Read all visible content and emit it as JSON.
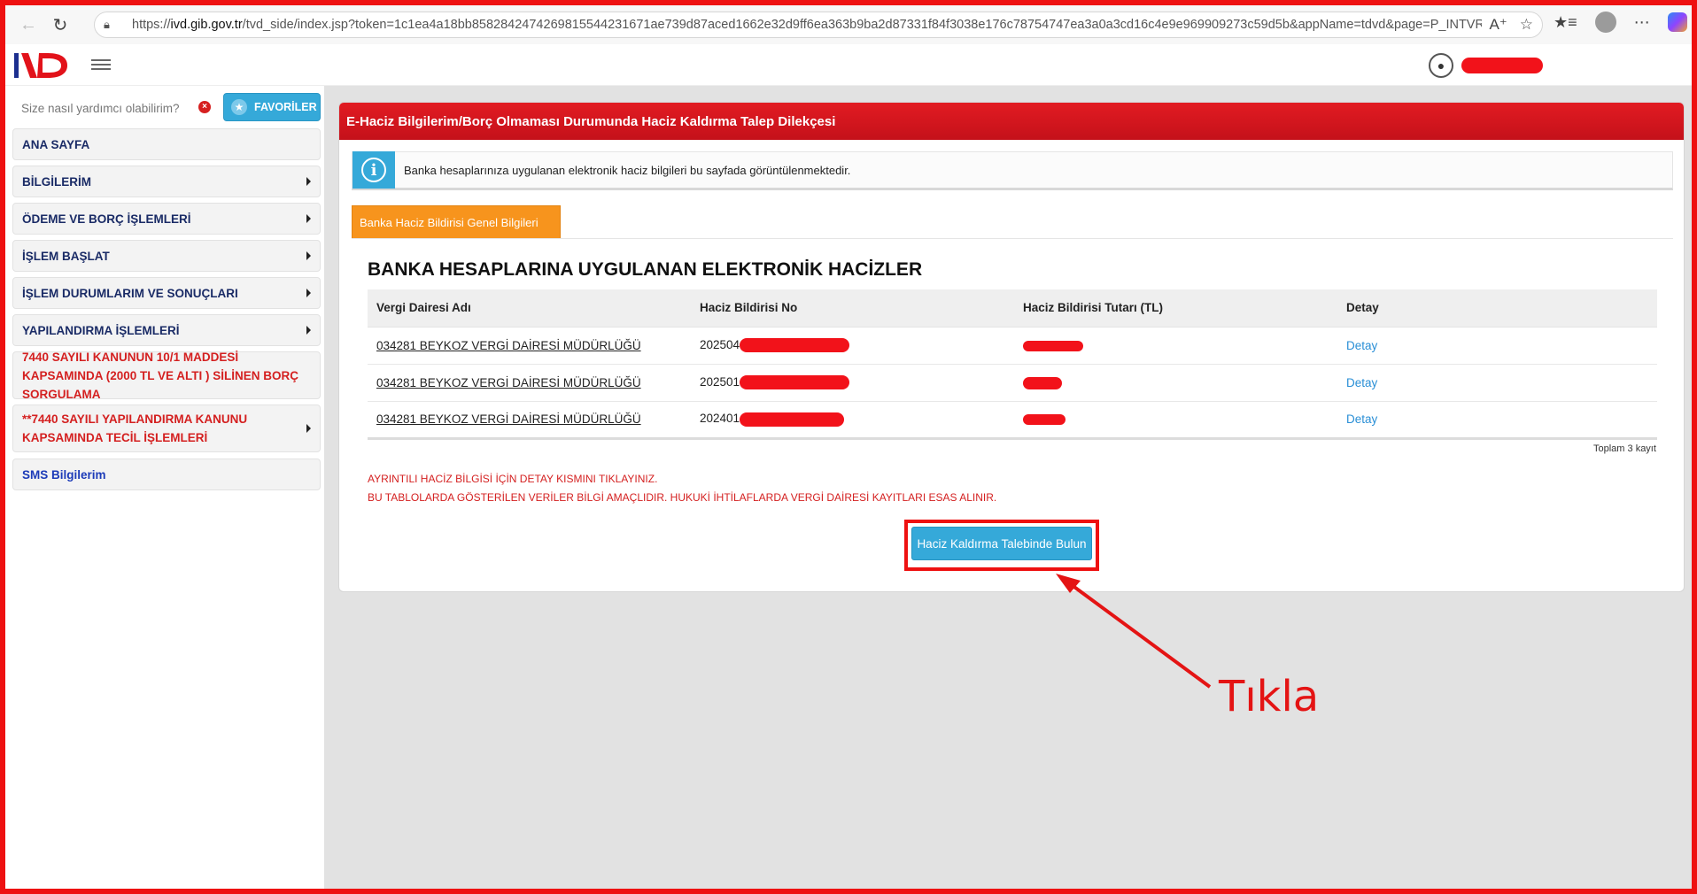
{
  "browser": {
    "url_prefix": "https://",
    "url_host": "ivd.gib.gov.tr",
    "url_rest": "/tvd_side/index.jsp?token=1c1ea4a18bb8582842474269815544231671ae739d87aced1662e32d9ff6ea363b9ba2d87331f84f3038e176c78754747ea3a0a3cd16c4e9e969909273c59d5b&appName=tdvd&page=P_INTVRG_IN..."
  },
  "header": {
    "logo_text": "iVD"
  },
  "sidebar": {
    "search_placeholder": "Size nasıl yardımcı olabilirim?",
    "favorites_label": "FAVORİLER",
    "items": [
      {
        "label": "ANA SAYFA",
        "has_arrow": false
      },
      {
        "label": "BİLGİLERİM",
        "has_arrow": true
      },
      {
        "label": "ÖDEME VE BORÇ İŞLEMLERİ",
        "has_arrow": true
      },
      {
        "label": "İŞLEM BAŞLAT",
        "has_arrow": true
      },
      {
        "label": "İŞLEM DURUMLARIM VE SONUÇLARI",
        "has_arrow": true
      },
      {
        "label": "YAPILANDIRMA İŞLEMLERİ",
        "has_arrow": true
      },
      {
        "label": "7440 SAYILI KANUNUN 10/1 MADDESİ KAPSAMINDA (2000 TL VE ALTI ) SİLİNEN BORÇ SORGULAMA",
        "has_arrow": false
      },
      {
        "label": "**7440 SAYILI YAPILANDIRMA KANUNU KAPSAMINDA TECİL İŞLEMLERİ",
        "has_arrow": true
      },
      {
        "label": "SMS Bilgilerim",
        "has_arrow": false
      }
    ]
  },
  "panel": {
    "title": "E-Haciz Bilgilerim/Borç Olmaması Durumunda Haciz Kaldırma Talep Dilekçesi",
    "info_text": "Banka hesaplarınıza uygulanan elektronik haciz bilgileri bu sayfada görüntülenmektedir.",
    "tab_label": "Banka Haciz Bildirisi Genel Bilgileri",
    "section_title": "BANKA HESAPLARINA UYGULANAN ELEKTRONİK HACİZLER",
    "table": {
      "headers": [
        "Vergi Dairesi Adı",
        "Haciz Bildirisi No",
        "Haciz Bildirisi Tutarı (TL)",
        "Detay"
      ],
      "rows": [
        {
          "office": "034281 BEYKOZ VERGİ DAİRESİ MÜDÜRLÜĞÜ",
          "number_prefix": "202504",
          "detail": "Detay"
        },
        {
          "office": "034281 BEYKOZ VERGİ DAİRESİ MÜDÜRLÜĞÜ",
          "number_prefix": "202501",
          "detail": "Detay"
        },
        {
          "office": "034281 BEYKOZ VERGİ DAİRESİ MÜDÜRLÜĞÜ",
          "number_prefix": "202401",
          "detail": "Detay"
        }
      ]
    },
    "total_text": "Toplam 3 kayıt",
    "warning_1": "AYRINTILI HACİZ BİLGİSİ İÇİN DETAY KISMINI TIKLAYINIZ.",
    "warning_2": "BU TABLOLARDA GÖSTERİLEN VERİLER BİLGİ AMAÇLIDIR. HUKUKİ İHTİLAFLARDA VERGİ DAİRESİ KAYITLARI ESAS ALINIR.",
    "request_button": "Haciz Kaldırma Talebinde Bulun"
  },
  "annotation": {
    "text": "Tıkla"
  },
  "colors": {
    "header_red": "#e21b22",
    "accent_blue": "#35a9d9",
    "tab_orange": "#f7941d",
    "annotation_red": "#ee1111",
    "menu_navy": "#1a2b66"
  }
}
